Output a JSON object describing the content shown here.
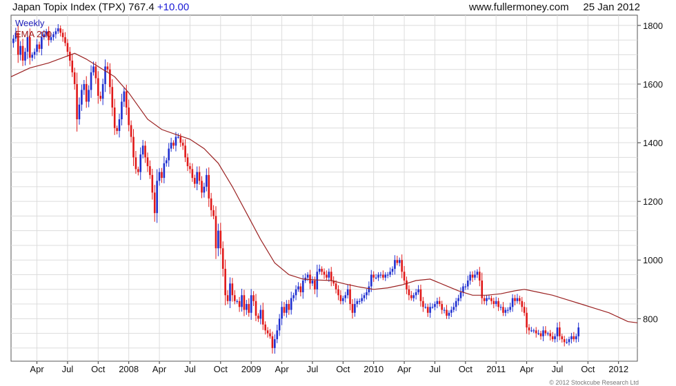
{
  "header": {
    "title": "Japan Topix Index (TPX)",
    "price": "767.4",
    "change": "+10.00",
    "site": "www.fullermoney.com",
    "date": "25 Jan 2012"
  },
  "legend": {
    "weekly": "Weekly",
    "ema": "EMA 200"
  },
  "copyright": "© 2012 Stockcube Research Ltd",
  "chart_data": {
    "type": "line",
    "title": "Japan Topix Index (TPX)",
    "xlabel": "",
    "ylabel": "",
    "ylim": [
      655,
      1835
    ],
    "grid": true,
    "legend_position": "top-left",
    "y_ticks": [
      800,
      1000,
      1200,
      1400,
      1600,
      1800
    ],
    "x_ticks": [
      "Apr",
      "Jul",
      "Oct",
      "2008",
      "Apr",
      "Jul",
      "Oct",
      "2009",
      "Apr",
      "Jul",
      "Oct",
      "2010",
      "Apr",
      "Jul",
      "Oct",
      "2011",
      "Apr",
      "Jul",
      "Oct",
      "2012"
    ],
    "x_tick_weeks": [
      11,
      24,
      37,
      50,
      63,
      76,
      89,
      102,
      115,
      128,
      141,
      154,
      167,
      180,
      193,
      206,
      219,
      232,
      245,
      258
    ],
    "colors": {
      "up": "#1f2fd0",
      "down": "#e01818",
      "ema": "#9a2020",
      "grid": "#dcdcdc"
    },
    "series": [
      {
        "name": "Weekly",
        "kind": "weekly_close",
        "values": [
          1740,
          1755,
          1775,
          1700,
          1730,
          1680,
          1710,
          1760,
          1690,
          1700,
          1710,
          1735,
          1720,
          1760,
          1770,
          1780,
          1750,
          1760,
          1770,
          1780,
          1790,
          1775,
          1760,
          1740,
          1710,
          1680,
          1640,
          1600,
          1480,
          1530,
          1580,
          1600,
          1540,
          1580,
          1640,
          1660,
          1620,
          1560,
          1550,
          1600,
          1660,
          1650,
          1590,
          1520,
          1450,
          1440,
          1480,
          1540,
          1575,
          1520,
          1460,
          1420,
          1350,
          1310,
          1300,
          1360,
          1390,
          1350,
          1320,
          1290,
          1230,
          1160,
          1270,
          1300,
          1280,
          1330,
          1340,
          1380,
          1400,
          1390,
          1420,
          1420,
          1400,
          1390,
          1350,
          1320,
          1310,
          1280,
          1260,
          1300,
          1270,
          1230,
          1250,
          1290,
          1210,
          1170,
          1150,
          1040,
          1100,
          1040,
          970,
          880,
          860,
          920,
          880,
          860,
          860,
          840,
          880,
          830,
          850,
          820,
          880,
          860,
          810,
          800,
          830,
          780,
          760,
          750,
          740,
          700,
          730,
          760,
          800,
          840,
          820,
          850,
          830,
          870,
          880,
          900,
          910,
          890,
          930,
          940,
          950,
          920,
          930,
          900,
          960,
          970,
          960,
          950,
          940,
          960,
          930,
          920,
          900,
          880,
          860,
          870,
          880,
          900,
          850,
          820,
          850,
          860,
          860,
          870,
          880,
          890,
          910,
          950,
          940,
          940,
          950,
          950,
          940,
          950,
          950,
          960,
          970,
          1000,
          990,
          1000,
          960,
          930,
          900,
          880,
          870,
          880,
          890,
          900,
          860,
          840,
          840,
          820,
          840,
          840,
          850,
          860,
          850,
          830,
          830,
          810,
          820,
          830,
          840,
          860,
          870,
          890,
          910,
          910,
          930,
          950,
          940,
          950,
          960,
          930,
          870,
          860,
          870,
          870,
          860,
          850,
          860,
          840,
          840,
          820,
          830,
          830,
          840,
          870,
          860,
          870,
          860,
          840,
          820,
          770,
          760,
          760,
          760,
          750,
          750,
          740,
          760,
          750,
          750,
          740,
          730,
          740,
          770,
          740,
          730,
          720,
          720,
          730,
          740,
          730,
          740,
          770
        ]
      },
      {
        "name": "EMA 200",
        "kind": "moving_average",
        "points": [
          [
            0,
            1625
          ],
          [
            8,
            1655
          ],
          [
            16,
            1672
          ],
          [
            22,
            1690
          ],
          [
            27,
            1705
          ],
          [
            32,
            1685
          ],
          [
            38,
            1655
          ],
          [
            44,
            1625
          ],
          [
            50,
            1570
          ],
          [
            58,
            1480
          ],
          [
            64,
            1445
          ],
          [
            70,
            1428
          ],
          [
            76,
            1412
          ],
          [
            82,
            1380
          ],
          [
            88,
            1330
          ],
          [
            94,
            1250
          ],
          [
            100,
            1160
          ],
          [
            106,
            1070
          ],
          [
            112,
            990
          ],
          [
            118,
            950
          ],
          [
            124,
            935
          ],
          [
            130,
            932
          ],
          [
            136,
            930
          ],
          [
            142,
            918
          ],
          [
            148,
            908
          ],
          [
            154,
            900
          ],
          [
            160,
            905
          ],
          [
            166,
            915
          ],
          [
            172,
            930
          ],
          [
            178,
            935
          ],
          [
            184,
            915
          ],
          [
            190,
            895
          ],
          [
            196,
            880
          ],
          [
            202,
            880
          ],
          [
            208,
            885
          ],
          [
            214,
            895
          ],
          [
            218,
            900
          ],
          [
            224,
            890
          ],
          [
            230,
            880
          ],
          [
            236,
            865
          ],
          [
            242,
            850
          ],
          [
            248,
            835
          ],
          [
            254,
            820
          ],
          [
            258,
            805
          ],
          [
            262,
            790
          ],
          [
            266,
            786
          ]
        ]
      }
    ]
  }
}
